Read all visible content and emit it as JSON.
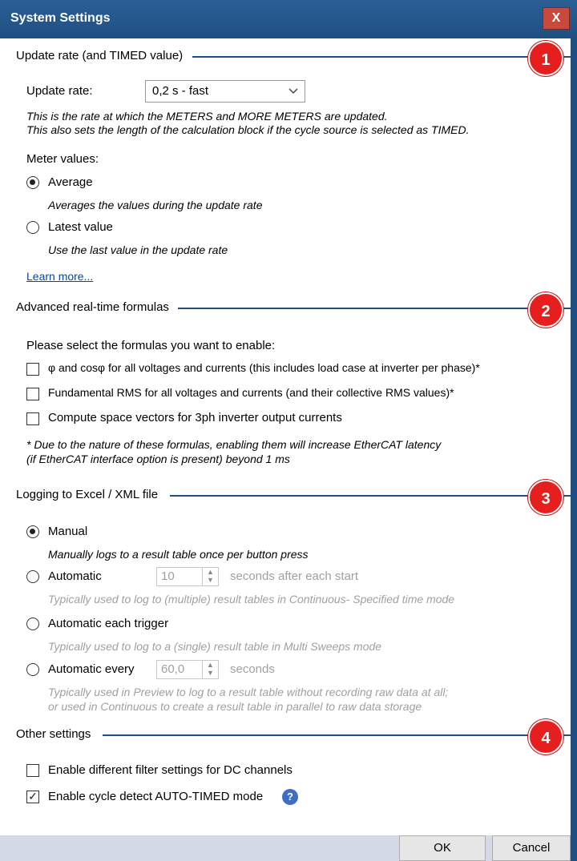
{
  "window": {
    "title": "System Settings",
    "close_glyph": "X"
  },
  "sections": {
    "update": {
      "header": "Update rate (and TIMED value)",
      "badge": "1",
      "rate_label": "Update rate:",
      "rate_value": "0,2 s - fast",
      "desc1": "This is the rate at which the METERS and MORE METERS are updated.",
      "desc2": "This also sets the length of the calculation block if the cycle source is selected as TIMED.",
      "meter_label": "Meter values:",
      "opt_average": "Average",
      "opt_average_desc": "Averages the values during the update rate",
      "opt_latest": "Latest value",
      "opt_latest_desc": "Use the last value in the update rate",
      "learn_more": "Learn more..."
    },
    "formulas": {
      "header": "Advanced real-time formulas",
      "badge": "2",
      "prompt": "Please select the formulas you want to enable:",
      "opt1": "φ and cosφ for all voltages and currents (this includes load case at inverter per phase)*",
      "opt2": "Fundamental RMS for all voltages and currents (and their collective RMS values)*",
      "opt3": "Compute space vectors for 3ph inverter output currents",
      "note1": "* Due to the nature of these formulas, enabling them will increase EtherCAT latency",
      "note2": "(if EtherCAT interface option is present) beyond 1 ms"
    },
    "logging": {
      "header": "Logging to Excel / XML file",
      "badge": "3",
      "opt_manual": "Manual",
      "opt_manual_desc": "Manually logs to a result table once per button press",
      "opt_automatic": "Automatic",
      "automatic_value": "10",
      "automatic_suffix": "seconds after each start",
      "opt_automatic_desc": "Typically used to log to (multiple) result tables in Continuous- Specified time mode",
      "opt_trigger": "Automatic each trigger",
      "opt_trigger_desc": "Typically used to log to a (single) result table in Multi Sweeps mode",
      "opt_every": "Automatic every",
      "every_value": "60,0",
      "every_suffix": "seconds",
      "opt_every_desc1": "Typically used in Preview to log to a result table without recording raw data at all;",
      "opt_every_desc2": "or used in Continuous to create a result table in parallel to raw data storage"
    },
    "other": {
      "header": "Other settings",
      "badge": "4",
      "opt_filter": "Enable different filter settings for DC channels",
      "opt_cycle": "Enable cycle detect AUTO-TIMED mode"
    }
  },
  "footer": {
    "ok": "OK",
    "cancel": "Cancel"
  },
  "icons": {
    "chevron": "chevron-down-icon",
    "help": "help-icon",
    "spin": "spin-arrows-icon"
  },
  "colors": {
    "title_bar": "#1f4f82",
    "badge": "#e61e1e",
    "link": "#0645ad"
  }
}
